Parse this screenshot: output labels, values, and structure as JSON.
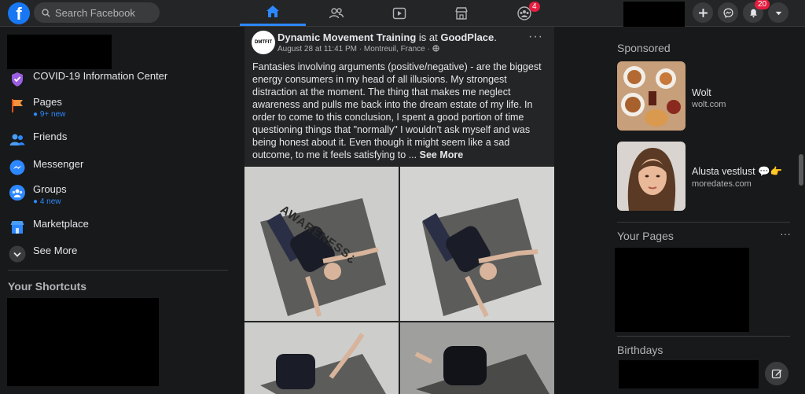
{
  "topbar": {
    "search_placeholder": "Search Facebook",
    "groups_badge": "4",
    "notifications_badge": "20"
  },
  "left": {
    "items": [
      {
        "label": "COVID-19 Information Center",
        "sub": ""
      },
      {
        "label": "Pages",
        "sub": "9+ new"
      },
      {
        "label": "Friends",
        "sub": ""
      },
      {
        "label": "Messenger",
        "sub": ""
      },
      {
        "label": "Groups",
        "sub": "4 new"
      },
      {
        "label": "Marketplace",
        "sub": ""
      },
      {
        "label": "See More",
        "sub": ""
      }
    ],
    "shortcuts_title": "Your Shortcuts"
  },
  "post": {
    "avatar_text": "DMTFIT",
    "author": "Dynamic Movement Training",
    "is_at": "is at",
    "place": "GoodPlace",
    "meta": "August 28 at 11:41 PM · Montreuil, France ·",
    "more": "···",
    "text": "Fantasies involving arguments (positive/negative) - are the biggest energy consumers in my head of all illusions. My strongest distraction at the moment. The thing that makes me neglect awareness and pulls me back into the dream estate of my life. In order to come to this conclusion, I spent a good portion of time questioning things that \"normally\" I wouldn't ask myself and was being honest about it. Even though it might seem like a sad outcome, to me it feels satisfying to ...",
    "see_more": "See More",
    "photo_caption": "AWARENESS¿"
  },
  "right": {
    "sponsored_title": "Sponsored",
    "ads": [
      {
        "title": "Wolt",
        "url": "wolt.com"
      },
      {
        "title": "Alusta vestlust 💬👉",
        "url": "moredates.com"
      }
    ],
    "your_pages_title": "Your Pages",
    "your_pages_more": "···",
    "birthdays_title": "Birthdays"
  }
}
